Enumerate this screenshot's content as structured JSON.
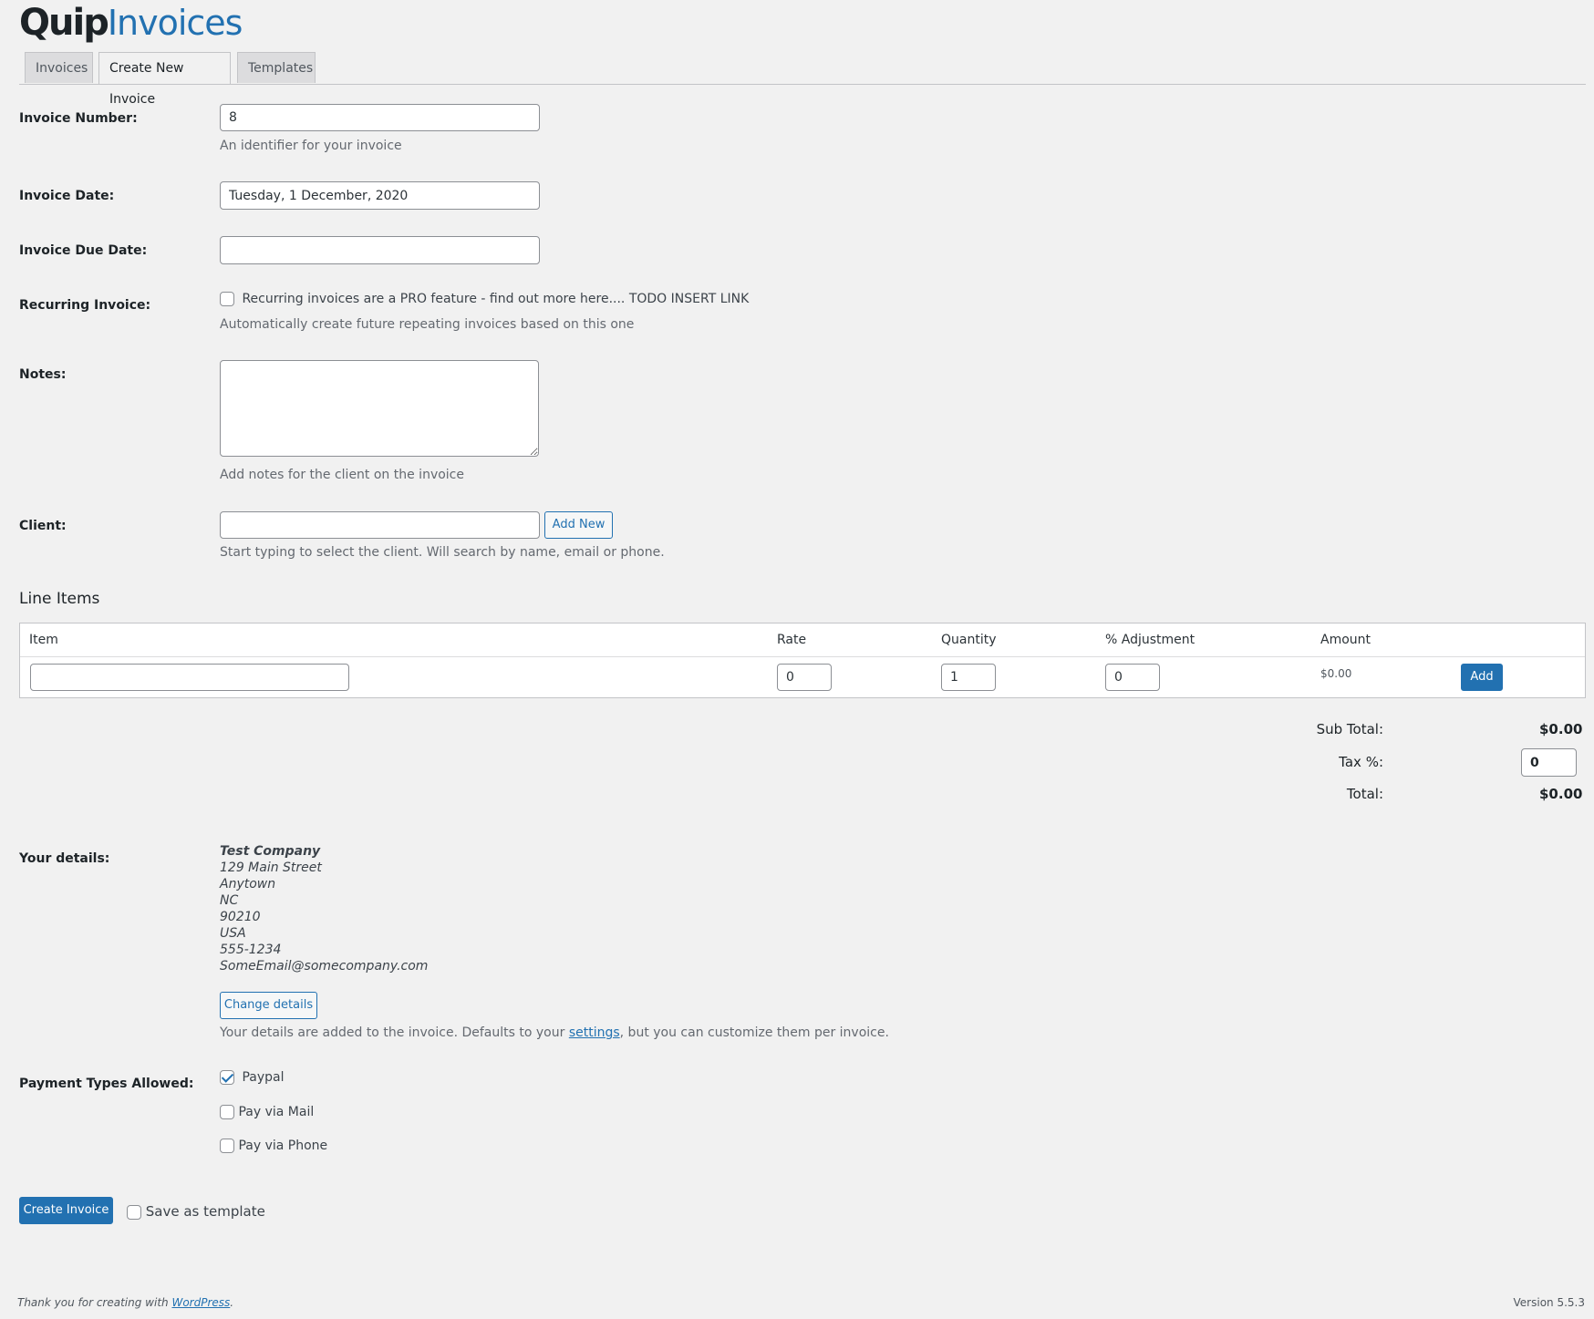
{
  "logo": {
    "part1": "Quip",
    "part2": "Invoices"
  },
  "tabs": [
    {
      "label": "Invoices"
    },
    {
      "label": "Create New Invoice"
    },
    {
      "label": "Templates"
    }
  ],
  "form": {
    "invoice_number": {
      "label": "Invoice Number:",
      "value": "8",
      "desc": "An identifier for your invoice"
    },
    "invoice_date": {
      "label": "Invoice Date:",
      "value": "Tuesday, 1 December, 2020"
    },
    "due_date": {
      "label": "Invoice Due Date:",
      "value": ""
    },
    "recurring": {
      "label": "Recurring Invoice:",
      "checkbox_label": "Recurring invoices are a PRO feature - find out more here.... TODO INSERT LINK",
      "desc": "Automatically create future repeating invoices based on this one"
    },
    "notes": {
      "label": "Notes:",
      "value": "",
      "desc": "Add notes for the client on the invoice"
    },
    "client": {
      "label": "Client:",
      "value": "",
      "add_button": "Add New",
      "desc": "Start typing to select the client. Will search by name, email or phone."
    }
  },
  "line_items": {
    "title": "Line Items",
    "headers": {
      "item": "Item",
      "rate": "Rate",
      "quantity": "Quantity",
      "adjustment": "% Adjustment",
      "amount": "Amount"
    },
    "row": {
      "item": "",
      "rate": "0",
      "quantity": "1",
      "adjustment": "0",
      "amount": "$0.00",
      "add_label": "Add"
    }
  },
  "totals": {
    "subtotal_label": "Sub Total:",
    "subtotal": "$0.00",
    "tax_label": "Tax %:",
    "tax": "0",
    "total_label": "Total:",
    "total": "$0.00"
  },
  "your_details": {
    "label": "Your details:",
    "company": "Test Company",
    "street": "129 Main Street",
    "city": "Anytown",
    "state": "NC",
    "zip": "90210",
    "country": "USA",
    "phone": "555-1234",
    "email": "SomeEmail@somecompany.com",
    "change_button": "Change details",
    "desc_before": "Your details are added to the invoice. Defaults to your ",
    "desc_link": "settings",
    "desc_after": ", but you can customize them per invoice."
  },
  "payment": {
    "label": "Payment Types Allowed:",
    "paypal": "Paypal",
    "mail": "Pay via Mail",
    "phone": "Pay via Phone"
  },
  "actions": {
    "create": "Create Invoice",
    "save_template": "Save as template"
  },
  "footer": {
    "thanks": "Thank you for creating with ",
    "wp_link": "WordPress",
    "period": ".",
    "version": "Version 5.5.3"
  }
}
